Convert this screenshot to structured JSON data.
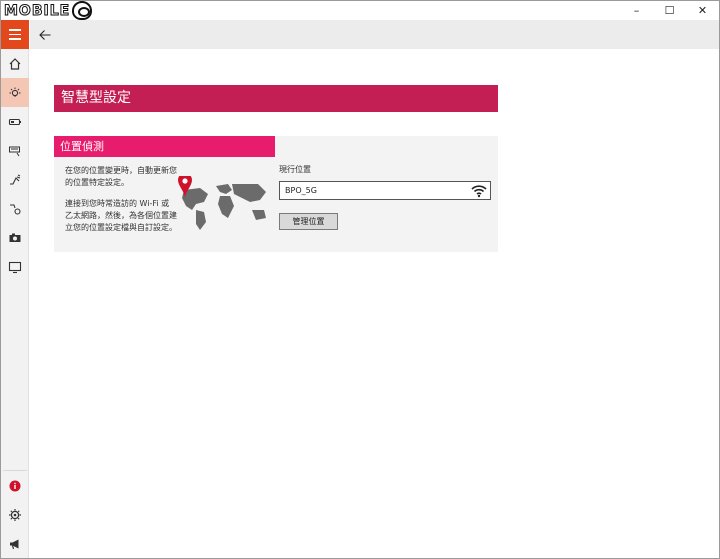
{
  "window": {
    "logo_text": "MOBILE",
    "controls": {
      "minimize": "–",
      "maximize": "☐",
      "close": "✕"
    }
  },
  "sidebar": {
    "menu_icon": "hamburger-icon",
    "items": [
      {
        "icon": "home-icon"
      },
      {
        "icon": "lightbulb-icon",
        "active": true
      },
      {
        "icon": "battery-tag-icon"
      },
      {
        "icon": "keyboard-light-icon"
      },
      {
        "icon": "wireless-signal-icon"
      },
      {
        "icon": "audio-settings-icon"
      },
      {
        "icon": "camera-icon"
      },
      {
        "icon": "monitor-icon"
      }
    ],
    "bottom_items": [
      {
        "icon": "info-icon"
      },
      {
        "icon": "gear-icon"
      },
      {
        "icon": "megaphone-icon"
      }
    ]
  },
  "header": {
    "back_icon": "back-arrow-icon"
  },
  "main": {
    "title": "智慧型設定",
    "panel": {
      "title": "位置偵測",
      "description1": "在您的位置變更時，自動更新您的位置特定設定。",
      "description2": "連接到您時常造訪的 Wi-Fi 或乙太網路，然後，為各個位置建立您的位置設定檔與自訂設定。",
      "current_location_label": "現行位置",
      "current_location_value": "BPO_5G",
      "manage_button": "管理位置"
    }
  },
  "colors": {
    "accent_orange": "#e2481b",
    "title_bar": "#c41f55",
    "panel_title": "#e81c6c"
  }
}
